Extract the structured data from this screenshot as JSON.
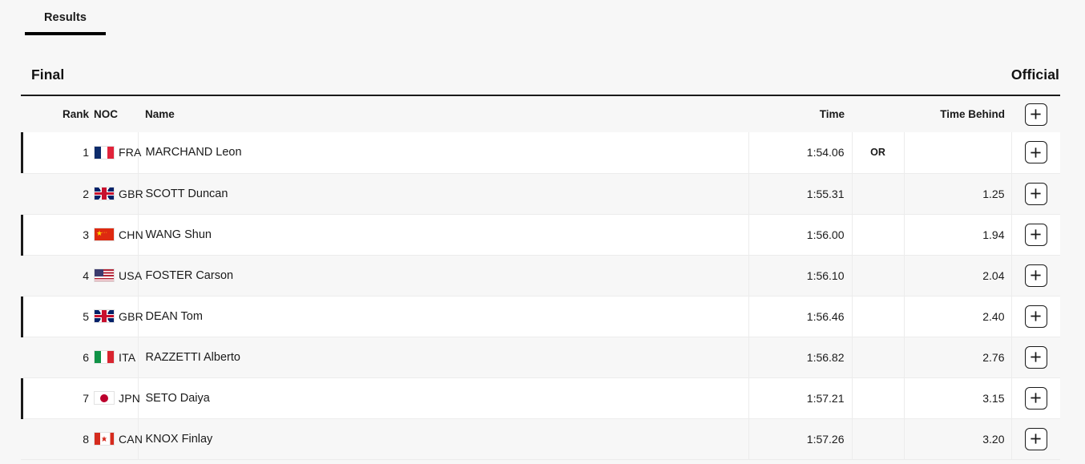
{
  "tabs": [
    {
      "label": "Results",
      "active": true
    }
  ],
  "section": {
    "title": "Final",
    "status": "Official"
  },
  "table": {
    "headers": {
      "rank": "Rank",
      "noc": "NOC",
      "name": "Name",
      "time": "Time",
      "record": "",
      "time_behind": "Time Behind",
      "expand": "+"
    },
    "expand_icon": "plus-icon",
    "rows": [
      {
        "rank": "1",
        "noc": "FRA",
        "flag": "flag-fra",
        "name": "MARCHAND Leon",
        "time": "1:54.06",
        "record": "OR",
        "time_behind": "",
        "expand": "+"
      },
      {
        "rank": "2",
        "noc": "GBR",
        "flag": "flag-gbr",
        "name": "SCOTT Duncan",
        "time": "1:55.31",
        "record": "",
        "time_behind": "1.25",
        "expand": "+"
      },
      {
        "rank": "3",
        "noc": "CHN",
        "flag": "flag-chn",
        "name": "WANG Shun",
        "time": "1:56.00",
        "record": "",
        "time_behind": "1.94",
        "expand": "+"
      },
      {
        "rank": "4",
        "noc": "USA",
        "flag": "flag-usa",
        "name": "FOSTER Carson",
        "time": "1:56.10",
        "record": "",
        "time_behind": "2.04",
        "expand": "+"
      },
      {
        "rank": "5",
        "noc": "GBR",
        "flag": "flag-gbr",
        "name": "DEAN Tom",
        "time": "1:56.46",
        "record": "",
        "time_behind": "2.40",
        "expand": "+"
      },
      {
        "rank": "6",
        "noc": "ITA",
        "flag": "flag-ita",
        "name": "RAZZETTI Alberto",
        "time": "1:56.82",
        "record": "",
        "time_behind": "2.76",
        "expand": "+"
      },
      {
        "rank": "7",
        "noc": "JPN",
        "flag": "flag-jpn",
        "name": "SETO Daiya",
        "time": "1:57.21",
        "record": "",
        "time_behind": "3.15",
        "expand": "+"
      },
      {
        "rank": "8",
        "noc": "CAN",
        "flag": "flag-can",
        "name": "KNOX Finlay",
        "time": "1:57.26",
        "record": "",
        "time_behind": "3.20",
        "expand": "+"
      }
    ]
  },
  "colors": {
    "page_background": "#f7f7f7",
    "row_odd": "#ffffff",
    "row_even": "#f7f7f7",
    "accent_bar": "#1a1a1a",
    "text": "#1a1a1a",
    "divider": "#ececec",
    "header_rule": "#1a1a1a"
  }
}
